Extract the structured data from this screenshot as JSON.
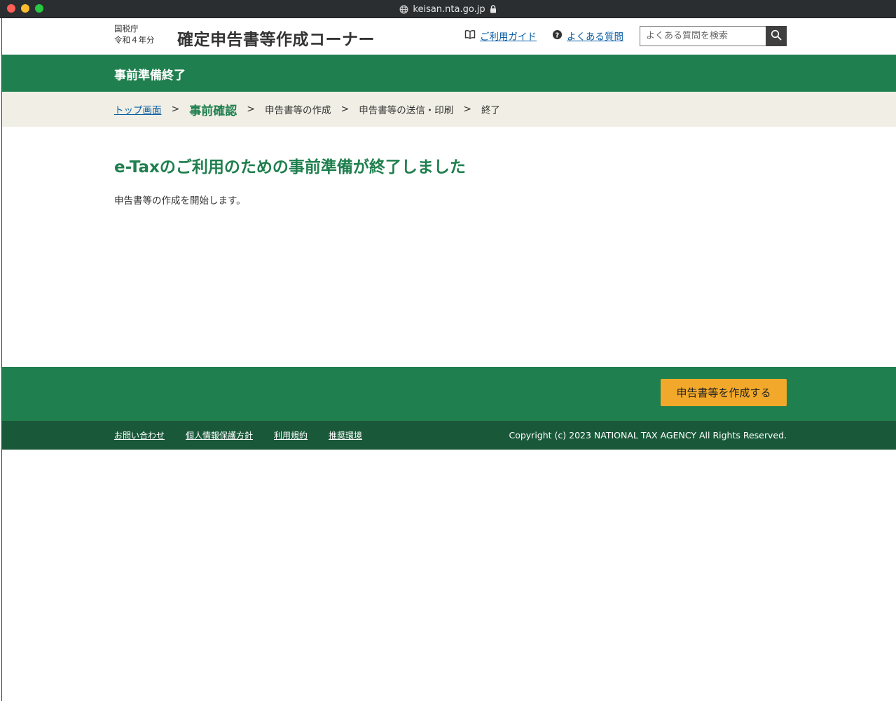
{
  "browser": {
    "url": "keisan.nta.go.jp"
  },
  "header": {
    "agency": "国税庁",
    "year": "令和４年分",
    "site_title": "確定申告書等作成コーナー",
    "guide_label": "ご利用ガイド",
    "faq_label": "よくある質問",
    "search_placeholder": "よくある質問を検索"
  },
  "titlebar": {
    "title": "事前準備終了"
  },
  "breadcrumb": {
    "items": [
      {
        "label": "トップ画面"
      },
      {
        "label": "事前確認"
      },
      {
        "label": "申告書等の作成"
      },
      {
        "label": "申告書等の送信・印刷"
      },
      {
        "label": "終了"
      }
    ]
  },
  "main": {
    "heading": "e-Taxのご利用のための事前準備が終了しました",
    "text": "申告書等の作成を開始します。"
  },
  "actions": {
    "primary_label": "申告書等を作成する"
  },
  "footer": {
    "links": [
      {
        "label": "お問い合わせ"
      },
      {
        "label": "個人情報保護方針"
      },
      {
        "label": "利用規約"
      },
      {
        "label": "推奨環境"
      }
    ],
    "copyright": "Copyright (c) 2023 NATIONAL TAX AGENCY All Rights Reserved."
  },
  "colors": {
    "brand_green": "#1f7f4e",
    "footer_green": "#19593a",
    "accent_orange": "#f2a92b",
    "breadcrumb_bg": "#f1efe5",
    "link_blue": "#0b5fa5"
  }
}
